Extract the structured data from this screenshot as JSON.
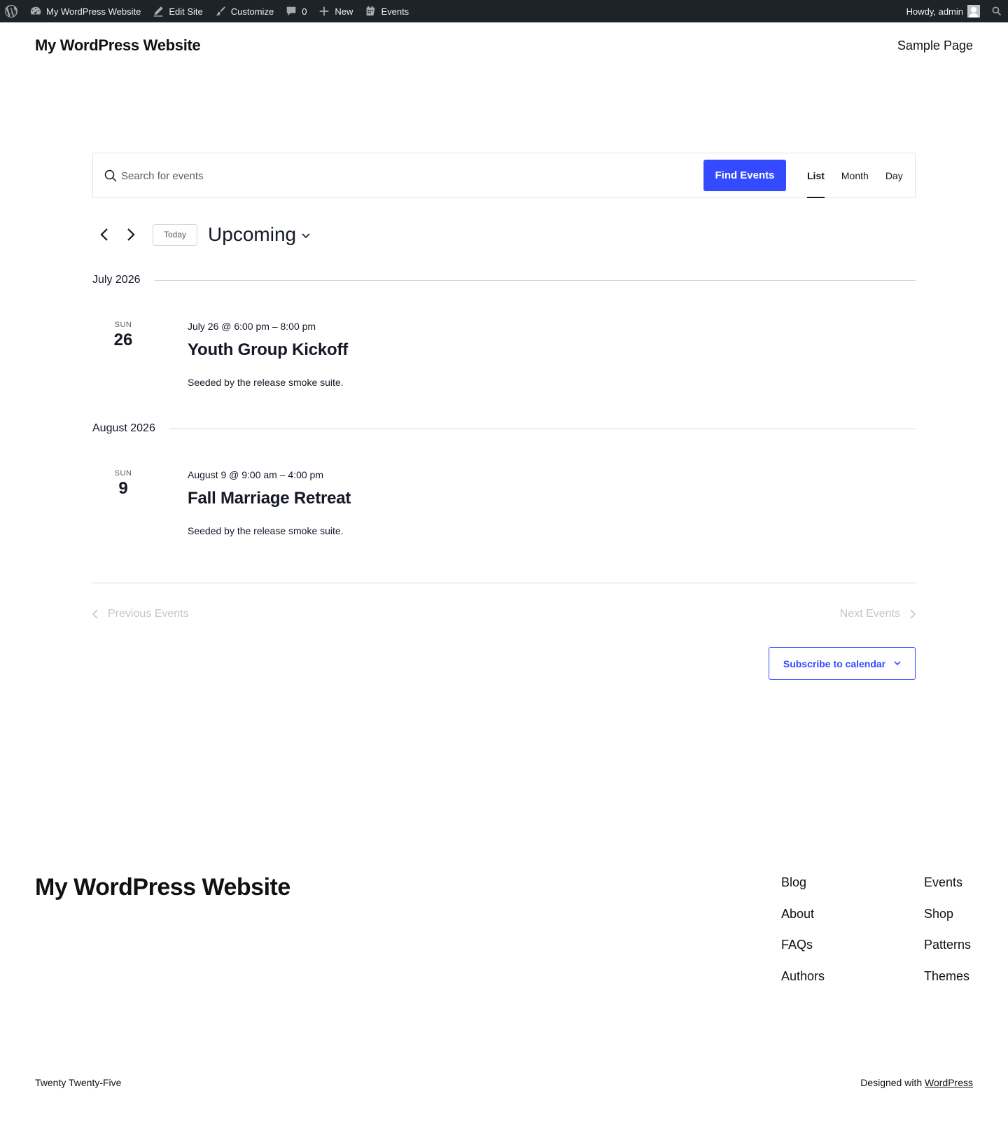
{
  "adminbar": {
    "site_name": "My WordPress Website",
    "edit_site": "Edit Site",
    "customize": "Customize",
    "comments_count": "0",
    "new": "New",
    "events": "Events",
    "howdy": "Howdy, admin"
  },
  "header": {
    "site_title": "My WordPress Website",
    "nav_item": "Sample Page"
  },
  "events_bar": {
    "search_placeholder": "Search for events",
    "find_button": "Find Events",
    "views": [
      "List",
      "Month",
      "Day"
    ],
    "active_view": "List"
  },
  "navigation": {
    "today": "Today",
    "range_label": "Upcoming"
  },
  "groups": [
    {
      "month": "July 2026",
      "events": [
        {
          "dow": "SUN",
          "day": "26",
          "time": "July 26 @ 6:00 pm – 8:00 pm",
          "title": "Youth Group Kickoff",
          "description": "Seeded by the release smoke suite."
        }
      ]
    },
    {
      "month": "August 2026",
      "events": [
        {
          "dow": "SUN",
          "day": "9",
          "time": "August 9 @ 9:00 am – 4:00 pm",
          "title": "Fall Marriage Retreat",
          "description": "Seeded by the release smoke suite."
        }
      ]
    }
  ],
  "pagination": {
    "previous": "Previous Events",
    "next": "Next Events"
  },
  "subscribe": "Subscribe to calendar",
  "footer": {
    "site_title": "My WordPress Website",
    "col1": [
      "Blog",
      "About",
      "FAQs",
      "Authors"
    ],
    "col2": [
      "Events",
      "Shop",
      "Patterns",
      "Themes"
    ],
    "theme_credit": "Twenty Twenty-Five",
    "designed_with": "Designed with",
    "designed_link": "WordPress"
  },
  "colors": {
    "accent": "#334aff",
    "adminbar_bg": "#1d2327",
    "text": "#141827",
    "muted": "#c5c5c5"
  }
}
